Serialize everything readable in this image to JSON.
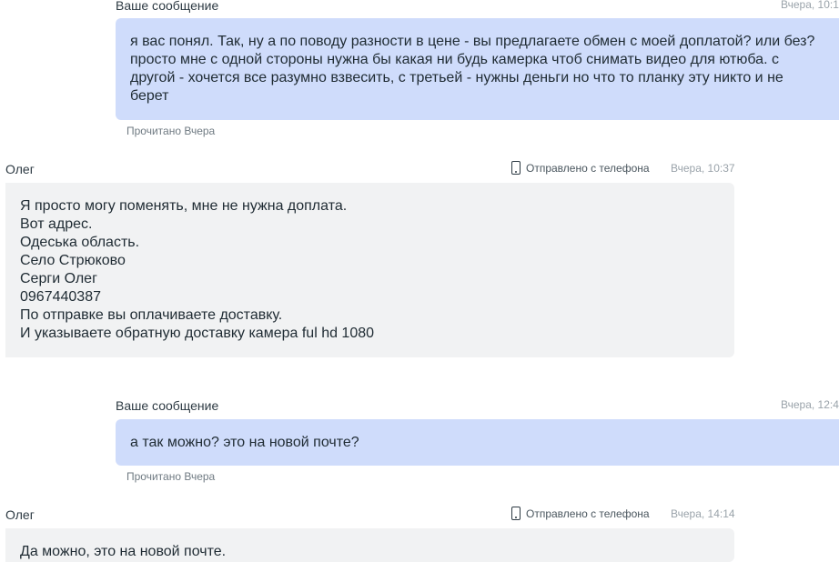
{
  "messages": [
    {
      "direction": "outgoing",
      "author": "Ваше сообщение",
      "time": "Вчера, 10:1",
      "text": "я вас понял. Так, ну а по поводу разности в цене - вы предлагаете обмен с моей доплатой? или без? просто мне с одной стороны нужна бы какая ни будь камерка чтоб снимать видео для ютюба. с другой - хочется все разумно взвесить, с третьей - нужны деньги но что то планку эту никто и не берет",
      "status": "Прочитано Вчера"
    },
    {
      "direction": "incoming",
      "author": "Олег",
      "sent_via": "Отправлено с телефона",
      "time": "Вчера, 10:37",
      "lines": [
        "Я просто могу поменять, мне не нужна доплата.",
        "Вот адрес.",
        "Одеська область.",
        "Село Стрюково",
        "Серги Олег",
        "0967440387",
        "По отправке вы оплачиваете доставку.",
        "И указываете обратную доставку камера ful hd 1080"
      ]
    },
    {
      "direction": "outgoing",
      "author": "Ваше сообщение",
      "time": "Вчера, 12:4",
      "text": "а так можно? это на новой почте?",
      "status": "Прочитано Вчера"
    },
    {
      "direction": "incoming",
      "author": "Олег",
      "sent_via": "Отправлено с телефона",
      "time": "Вчера, 14:14",
      "lines": [
        "Да можно, это на новой почте."
      ]
    }
  ],
  "icons": {
    "sent_via": "phone-icon"
  },
  "colors": {
    "outgoing_bubble": "#cfdcfb",
    "incoming_bubble": "#f1f2f3",
    "timestamp": "#9aa3aa"
  }
}
